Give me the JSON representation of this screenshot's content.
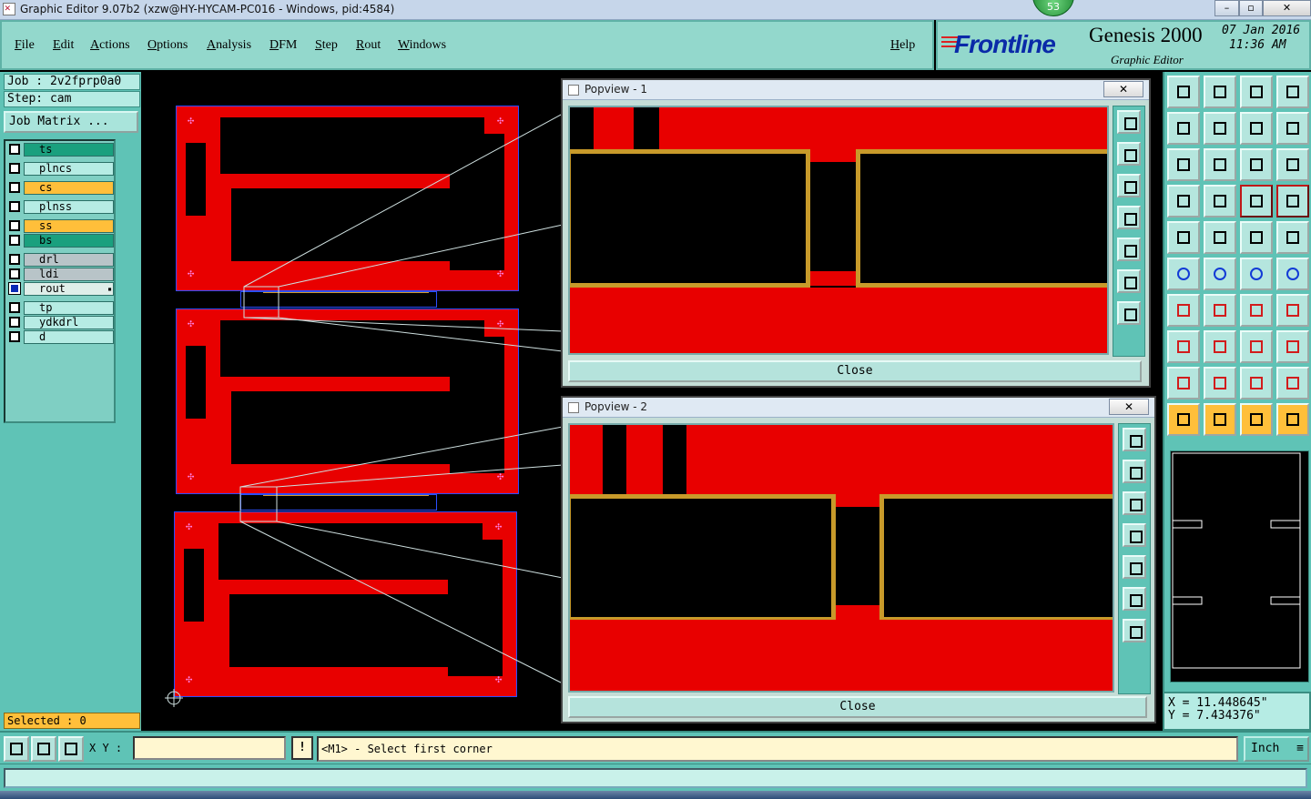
{
  "window": {
    "title": "Graphic Editor 9.07b2 (xzw@HY-HYCAM-PC016 - Windows, pid:4584)",
    "badge": "53",
    "controls": {
      "minimize": "–",
      "maximize": "▫",
      "close": "✕"
    }
  },
  "menu": {
    "file": "File",
    "edit": "Edit",
    "actions": "Actions",
    "options": "Options",
    "analysis": "Analysis",
    "dfm": "DFM",
    "step": "Step",
    "rout": "Rout",
    "windows": "Windows",
    "help": "Help"
  },
  "logo": {
    "brand": "Frontline",
    "product": "Genesis 2000",
    "subtitle": "Graphic Editor",
    "date": "07 Jan 2016",
    "time": "11:36 AM"
  },
  "job": {
    "job_line": "Job : 2v2fprp0a0",
    "step_line": "Step: cam",
    "matrix_button": "Job Matrix ..."
  },
  "layers": [
    {
      "name": "ts",
      "color": "#ff2020",
      "row_color": "#1aa07e",
      "checked": false
    },
    {
      "name": "plncs",
      "color": "#b6ece4",
      "row_color": "#b6ece4",
      "checked": false
    },
    {
      "name": "cs",
      "color": "#ffbf3a",
      "row_color": "#ffbf3a",
      "checked": false
    },
    {
      "name": "plnss",
      "color": "#b6ece4",
      "row_color": "#b6ece4",
      "checked": false
    },
    {
      "name": "ss",
      "color": "#ffbf3a",
      "row_color": "#ffbf3a",
      "checked": false
    },
    {
      "name": "bs",
      "color": "#1aa07e",
      "row_color": "#1aa07e",
      "checked": false
    },
    {
      "name": "drl",
      "color": "#b8c4c8",
      "row_color": "#b8c4c8",
      "checked": false
    },
    {
      "name": "ldi",
      "color": "#b8c4c8",
      "row_color": "#b8c4c8",
      "checked": false
    },
    {
      "name": "rout",
      "color": "#22a822",
      "row_color": "#dfeee9",
      "checked": true
    },
    {
      "name": "tp",
      "color": "#b6ece4",
      "row_color": "#b6ece4",
      "checked": false
    },
    {
      "name": "ydkdrl",
      "color": "#1a1aff",
      "row_color": "#b6ece4",
      "checked": false
    },
    {
      "name": "d",
      "color": "#b6ece4",
      "row_color": "#b6ece4",
      "checked": false
    }
  ],
  "selected_text": "Selected : 0",
  "popview1": {
    "title": "Popview - 1",
    "close_label": "Close"
  },
  "popview2": {
    "title": "Popview - 2",
    "close_label": "Close"
  },
  "coords": {
    "x": "X = 11.448645\"",
    "y": "Y = 7.434376\""
  },
  "status": {
    "xy_label": "X Y :",
    "xy_value": "",
    "warn": "!",
    "prompt": "<M1> - Select first corner",
    "units": "Inch"
  },
  "colors": {
    "copper": "#e80000",
    "outline": "#2b4fff",
    "pad_outline": "#c89a2a",
    "panel": "#5fc3b6",
    "selected_bg": "#ffbf3a"
  },
  "tools": [
    "move-up-icon",
    "move-down-icon",
    "home-icon",
    "split-icon",
    "pan-left-icon",
    "pan-right-icon",
    "zoom-fit-icon",
    "flip-icon",
    "zoom-extents-icon",
    "zoom-center-icon",
    "scale-1-2-icon",
    "help-icon",
    "tune-icon",
    "key-icon",
    "layers-red-icon",
    "layers-red2-icon",
    "snap-icon",
    "measure-icon",
    "ruler-icon",
    "circle-icon",
    "connect-icon",
    "delete-icon",
    "vertex-icon",
    "node-icon",
    "angle-icon",
    "slash-icon",
    "arc-icon",
    "fill-icon",
    "scatter-icon",
    "cut-icon",
    "window-icon",
    "shapes-icon",
    "triangle1-icon",
    "triangle2-icon",
    "triangle3-icon",
    "triangle4-icon",
    "select-icon",
    "select-box-icon",
    "select-circle-icon",
    "select-multi-icon"
  ]
}
